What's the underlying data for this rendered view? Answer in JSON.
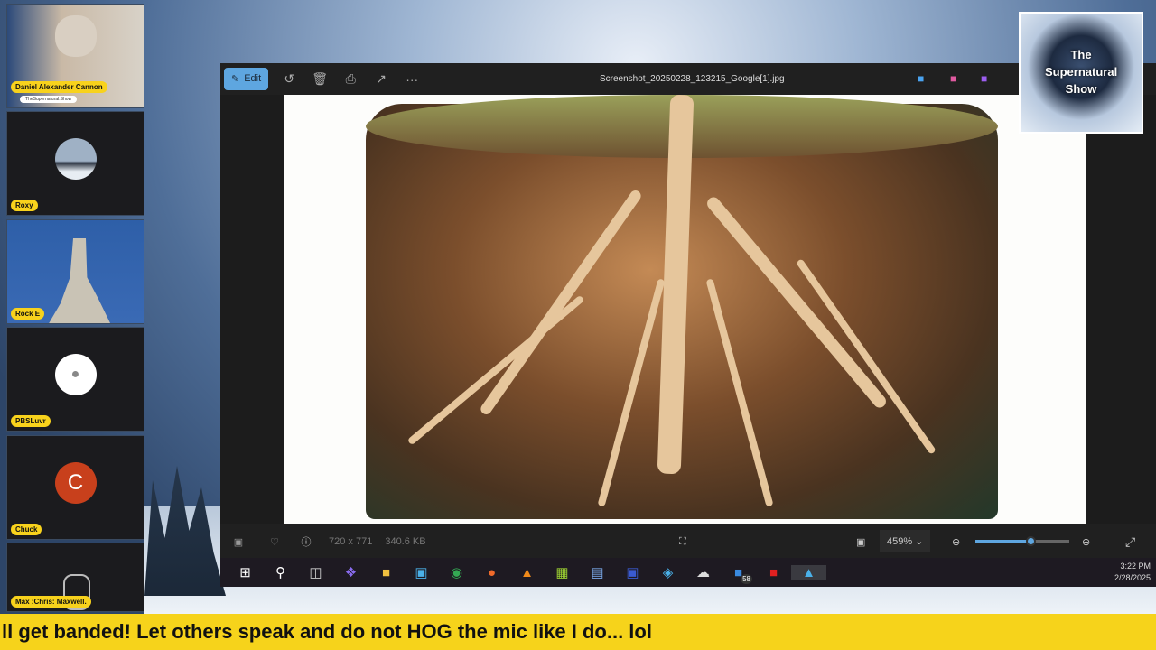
{
  "participants": [
    {
      "name": "Daniel Alexander Cannon",
      "subtitle": "TheSupernatural.Show",
      "type": "video"
    },
    {
      "name": "Roxy",
      "type": "image"
    },
    {
      "name": "Rock E",
      "type": "image"
    },
    {
      "name": "PBSLuvr",
      "type": "default-avatar"
    },
    {
      "name": "Chuck",
      "type": "initial",
      "initial": "C",
      "color": "#c8401c"
    },
    {
      "name": "Max :Chris: Maxwell.",
      "type": "image"
    }
  ],
  "viewer": {
    "edit_label": "Edit",
    "filename": "Screenshot_20250228_123215_Google[1].jpg",
    "dimensions": "720 x 771",
    "file_size": "340.6 KB",
    "zoom": "459%",
    "zoom_slider_fraction": 0.6
  },
  "taskbar": {
    "time": "3:22 PM",
    "date": "2/28/2025",
    "badge": "58"
  },
  "logo": {
    "text": "The Supernatural Show"
  },
  "ticker": {
    "text": "ll get banded! Let others speak and do not HOG the mic like I do... lol"
  },
  "colors": {
    "accent": "#5ea6e0",
    "name_tag": "#f8d21c"
  }
}
